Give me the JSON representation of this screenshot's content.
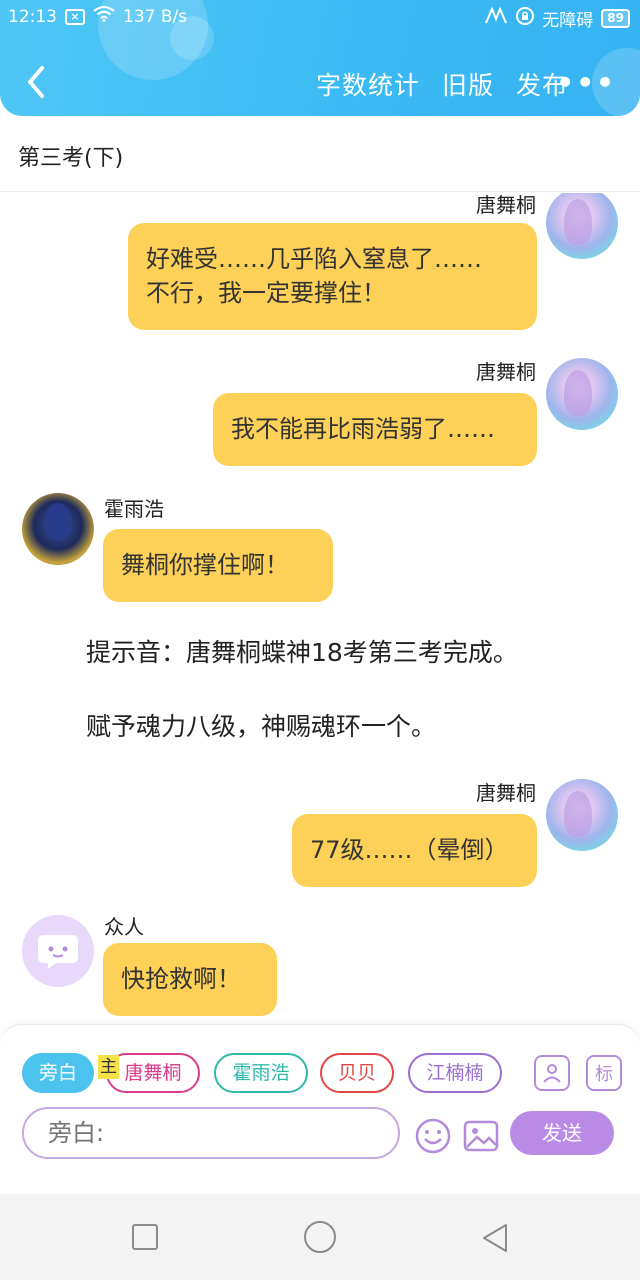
{
  "status_bar": {
    "time": "12:13",
    "speed": "137 B/s",
    "accessibility": "无障碍",
    "battery": "89"
  },
  "nav": {
    "actions": [
      "字数统计",
      "旧版",
      "发布"
    ],
    "more": "•••"
  },
  "chapter_title": "第三考(下)",
  "messages": [
    {
      "speaker": "唐舞桐",
      "text": "好难受……几乎陷入窒息了……\n不行，我一定要撑住！"
    },
    {
      "speaker": "唐舞桐",
      "text": "我不能再比雨浩弱了……"
    },
    {
      "speaker": "霍雨浩",
      "text": "舞桐你撑住啊！"
    },
    {
      "narration": "提示音：唐舞桐蝶神18考第三考完成。"
    },
    {
      "narration": "赋予魂力八级，神赐魂环一个。"
    },
    {
      "speaker": "唐舞桐",
      "text": "77级……（晕倒）"
    },
    {
      "speaker": "众人",
      "text": "快抢救啊！"
    }
  ],
  "roles": [
    "旁白",
    "唐舞桐",
    "霍雨浩",
    "贝贝",
    "江楠楠"
  ],
  "main_tag": "主",
  "tools": {
    "label_tag": "标"
  },
  "input": {
    "placeholder": "旁白:"
  },
  "send_label": "发送",
  "colors": {
    "header": "#3ab9f3",
    "bubble": "#fdd158",
    "send": "#b98be4",
    "narrator_chip": "#4cc2ef"
  }
}
